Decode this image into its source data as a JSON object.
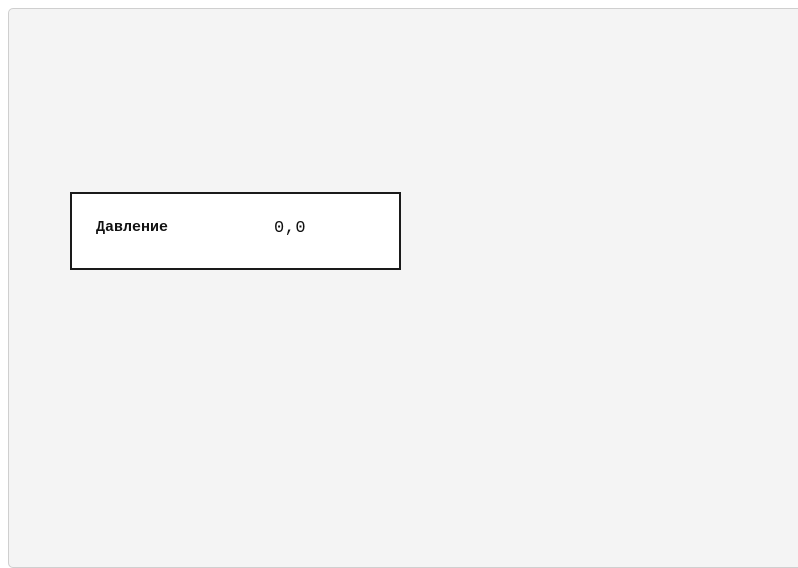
{
  "readout": {
    "label": "Давление",
    "value": "0,0"
  }
}
